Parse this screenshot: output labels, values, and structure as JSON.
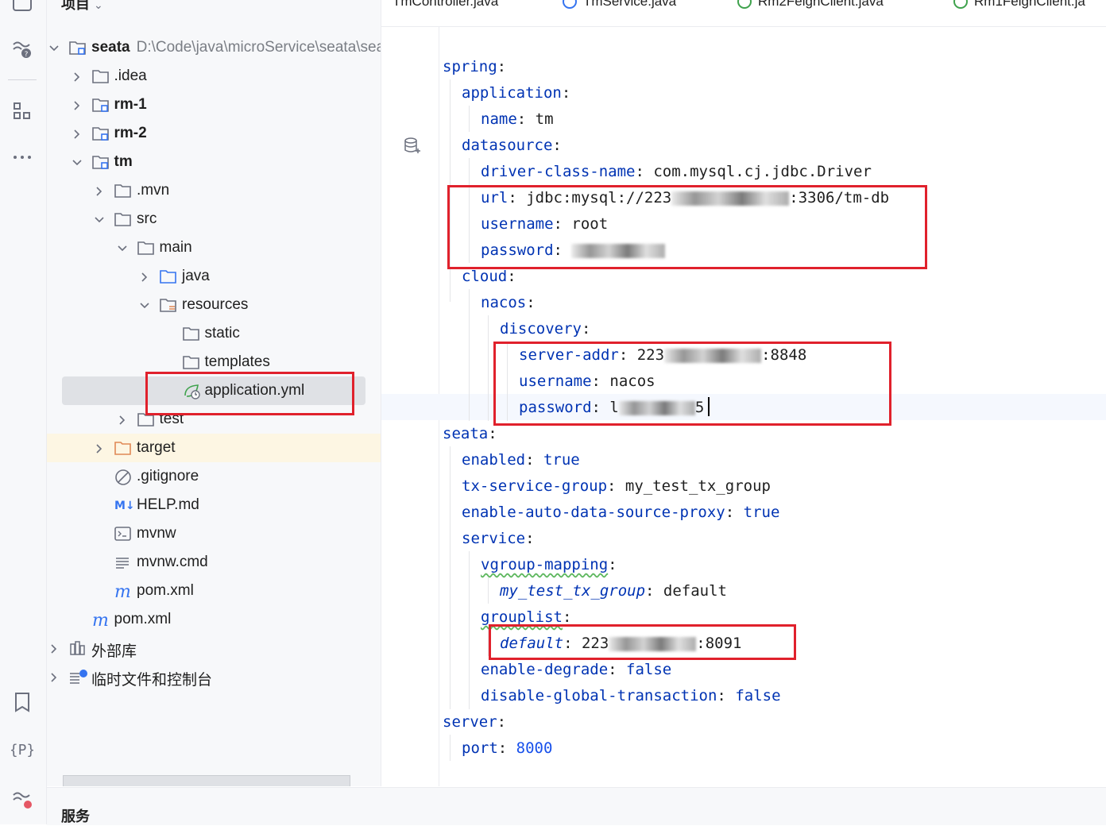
{
  "panel": {
    "title": "项目"
  },
  "tree": [
    {
      "label": "seata",
      "path": "D:\\Code\\java\\microService\\seata\\sea",
      "bold": true
    },
    {
      "label": ".idea"
    },
    {
      "label": "rm-1",
      "bold": true
    },
    {
      "label": "rm-2",
      "bold": true
    },
    {
      "label": "tm",
      "bold": true
    },
    {
      "label": ".mvn"
    },
    {
      "label": "src"
    },
    {
      "label": "main"
    },
    {
      "label": "java"
    },
    {
      "label": "resources"
    },
    {
      "label": "static"
    },
    {
      "label": "templates"
    },
    {
      "label": "application.yml"
    },
    {
      "label": "test"
    },
    {
      "label": "target"
    },
    {
      "label": ".gitignore"
    },
    {
      "label": "HELP.md"
    },
    {
      "label": "mvnw"
    },
    {
      "label": "mvnw.cmd"
    },
    {
      "label": "pom.xml"
    },
    {
      "label": "pom.xml"
    },
    {
      "label": "外部库"
    },
    {
      "label": "临时文件和控制台"
    }
  ],
  "tabs": [
    {
      "label": "TmController.java"
    },
    {
      "label": "TmService.java"
    },
    {
      "label": "Rm2FeignClient.java"
    },
    {
      "label": "Rm1FeignClient.ja"
    }
  ],
  "services": {
    "title": "服务"
  },
  "code": {
    "l1_key": "spring",
    "l2_key": "application",
    "l3_key": "name",
    "l3_val": "tm",
    "l4_key": "datasource",
    "l5_key": "driver-class-name",
    "l5_val": "com.mysql.cj.jdbc.Driver",
    "l6_key": "url",
    "l6_val_a": "jdbc:mysql://223",
    "l6_val_b": ":3306/tm-db",
    "l7_key": "username",
    "l7_val": "root",
    "l8_key": "password",
    "l9_key": "cloud",
    "l10_key": "nacos",
    "l11_key": "discovery",
    "l12_key": "server-addr",
    "l12_val_a": "223",
    "l12_val_b": ":8848",
    "l13_key": "username",
    "l13_val": "nacos",
    "l14_key": "password",
    "l14_val_a": "l",
    "l14_val_b": "5",
    "l15_key": "seata",
    "l16_key": "enabled",
    "l16_val": "true",
    "l17_key": "tx-service-group",
    "l17_val": "my_test_tx_group",
    "l18_key": "enable-auto-data-source-proxy",
    "l18_val": "true",
    "l19_key": "service",
    "l20_key": "vgroup-mapping",
    "l21_key": "my_test_tx_group",
    "l21_val": "default",
    "l22_key": "grouplist",
    "l23_key": "default",
    "l23_val_a": "223",
    "l23_val_b": ":8091",
    "l24_key": "enable-degrade",
    "l24_val": "false",
    "l25_key": "disable-global-transaction",
    "l25_val": "false",
    "l26_key": "server",
    "l27_key": "port",
    "l27_val": "8000"
  }
}
